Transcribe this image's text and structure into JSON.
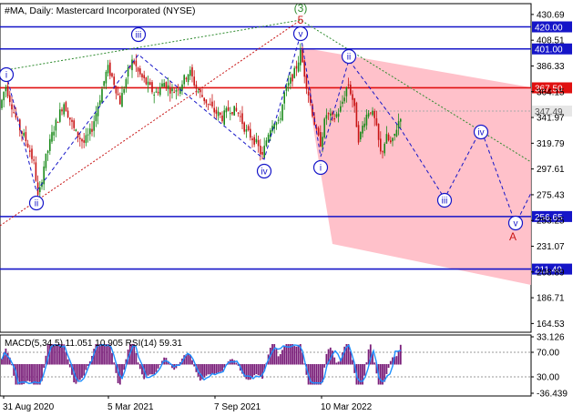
{
  "header": {
    "title": "#MA, Daily:  Mastercard Incorporated (NYSE)"
  },
  "chart_data": {
    "type": "candlestick",
    "symbol": "#MA",
    "timeframe": "Daily",
    "instrument": "Mastercard Incorporated (NYSE)",
    "y_ticks": [
      "430.69",
      "408.51",
      "386.33",
      "364.15",
      "341.97",
      "319.79",
      "297.61",
      "275.43",
      "253.25",
      "231.07",
      "208.89",
      "186.71",
      "164.53"
    ],
    "x_ticks": [
      "31 Aug 2020",
      "5 Mar 2021",
      "7 Sep 2021",
      "10 Mar 2022"
    ],
    "ylim": [
      157.0,
      440.0
    ],
    "current_price": "347.49",
    "levels": [
      {
        "value": 420.0,
        "label": "420.00",
        "color": "#1515c8"
      },
      {
        "value": 401.0,
        "label": "401.00",
        "color": "#1515c8"
      },
      {
        "value": 367.5,
        "label": "367.50",
        "color": "#e01010"
      },
      {
        "value": 256.65,
        "label": "256.65",
        "color": "#1515c8"
      },
      {
        "value": 211.4,
        "label": "211.40",
        "color": "#1515c8"
      }
    ],
    "wave_labels": [
      {
        "text": "i",
        "style": "circle-blue"
      },
      {
        "text": "ii",
        "style": "circle-blue"
      },
      {
        "text": "iii",
        "style": "circle-blue"
      },
      {
        "text": "iv",
        "style": "circle-blue"
      },
      {
        "text": "v",
        "style": "circle-blue"
      },
      {
        "text": "(3)",
        "style": "green"
      },
      {
        "text": "5",
        "style": "red"
      },
      {
        "text": "i",
        "style": "circle-blue"
      },
      {
        "text": "ii",
        "style": "circle-blue"
      },
      {
        "text": "iii",
        "style": "circle-blue"
      },
      {
        "text": "iv",
        "style": "circle-blue"
      },
      {
        "text": "v",
        "style": "circle-blue"
      },
      {
        "text": "A",
        "style": "red"
      }
    ],
    "price_path": [
      [
        0,
        350
      ],
      [
        6,
        370
      ],
      [
        20,
        335
      ],
      [
        30,
        320
      ],
      [
        38,
        300
      ],
      [
        42,
        270
      ],
      [
        48,
        300
      ],
      [
        58,
        330
      ],
      [
        70,
        355
      ],
      [
        82,
        330
      ],
      [
        92,
        320
      ],
      [
        100,
        330
      ],
      [
        110,
        360
      ],
      [
        118,
        385
      ],
      [
        124,
        375
      ],
      [
        132,
        355
      ],
      [
        140,
        380
      ],
      [
        146,
        392
      ],
      [
        152,
        380
      ],
      [
        160,
        372
      ],
      [
        170,
        362
      ],
      [
        180,
        372
      ],
      [
        190,
        364
      ],
      [
        198,
        370
      ],
      [
        208,
        382
      ],
      [
        216,
        366
      ],
      [
        226,
        356
      ],
      [
        234,
        348
      ],
      [
        244,
        342
      ],
      [
        252,
        350
      ],
      [
        262,
        346
      ],
      [
        270,
        330
      ],
      [
        280,
        322
      ],
      [
        288,
        308
      ],
      [
        294,
        328
      ],
      [
        300,
        340
      ],
      [
        306,
        336
      ],
      [
        312,
        362
      ],
      [
        318,
        372
      ],
      [
        324,
        382
      ],
      [
        330,
        398
      ],
      [
        336,
        372
      ],
      [
        342,
        350
      ],
      [
        348,
        326
      ],
      [
        352,
        320
      ],
      [
        358,
        345
      ],
      [
        366,
        340
      ],
      [
        374,
        350
      ],
      [
        382,
        372
      ],
      [
        388,
        355
      ],
      [
        394,
        322
      ],
      [
        400,
        340
      ],
      [
        406,
        350
      ],
      [
        412,
        338
      ],
      [
        418,
        310
      ],
      [
        424,
        325
      ],
      [
        430,
        318
      ],
      [
        436,
        335
      ],
      [
        441,
        347
      ]
    ],
    "macd": {
      "label": "MACD(5,34,5) 11.051 10.905 RSI(14) 59.31",
      "y_ticks": [
        "33.126",
        "70.00",
        "30.00",
        "-36.439"
      ]
    }
  }
}
